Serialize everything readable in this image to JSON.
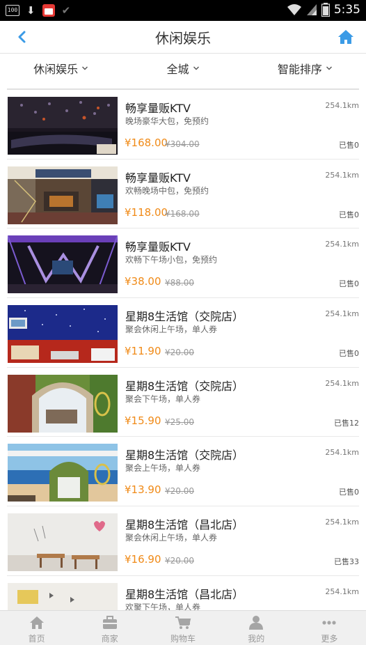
{
  "status_bar": {
    "battery_badge": "100",
    "time": "5:35"
  },
  "header": {
    "title": "休闲娱乐"
  },
  "filters": [
    {
      "label": "休闲娱乐"
    },
    {
      "label": "全城"
    },
    {
      "label": "智能排序"
    }
  ],
  "items": [
    {
      "name": "畅享量贩KTV",
      "desc": "晚场豪华大包，免预约",
      "price": "¥168.00",
      "original": "¥304.00",
      "distance": "254.1km",
      "sold": "已售0"
    },
    {
      "name": "畅享量贩KTV",
      "desc": "欢畅晚场中包，免预约",
      "price": "¥118.00",
      "original": "¥168.00",
      "distance": "254.1km",
      "sold": "已售0"
    },
    {
      "name": "畅享量贩KTV",
      "desc": "欢畅下午场小包，免预约",
      "price": "¥38.00",
      "original": "¥88.00",
      "distance": "254.1km",
      "sold": "已售0"
    },
    {
      "name": "星期8生活馆（交院店）",
      "desc": "聚会休闲上午场，单人券",
      "price": "¥11.90",
      "original": "¥20.00",
      "distance": "254.1km",
      "sold": "已售0"
    },
    {
      "name": "星期8生活馆（交院店）",
      "desc": "聚会下午场，单人券",
      "price": "¥15.90",
      "original": "¥25.00",
      "distance": "254.1km",
      "sold": "已售12"
    },
    {
      "name": "星期8生活馆（交院店）",
      "desc": "聚会上午场，单人券",
      "price": "¥13.90",
      "original": "¥20.00",
      "distance": "254.1km",
      "sold": "已售0"
    },
    {
      "name": "星期8生活馆（昌北店）",
      "desc": "聚会休闲上午场，单人券",
      "price": "¥16.90",
      "original": "¥20.00",
      "distance": "254.1km",
      "sold": "已售33"
    },
    {
      "name": "星期8生活馆（昌北店）",
      "desc": "欢聚下午场，单人券",
      "price": "",
      "original": "",
      "distance": "254.1km",
      "sold": ""
    }
  ],
  "tabs": [
    {
      "label": "首页",
      "icon": "home-icon"
    },
    {
      "label": "商家",
      "icon": "briefcase-icon"
    },
    {
      "label": "购物车",
      "icon": "cart-icon"
    },
    {
      "label": "我的",
      "icon": "user-icon"
    },
    {
      "label": "更多",
      "icon": "more-icon"
    }
  ],
  "colors": {
    "accent": "#3b9be6",
    "price": "#f08a17",
    "tab_inactive": "#999999"
  }
}
